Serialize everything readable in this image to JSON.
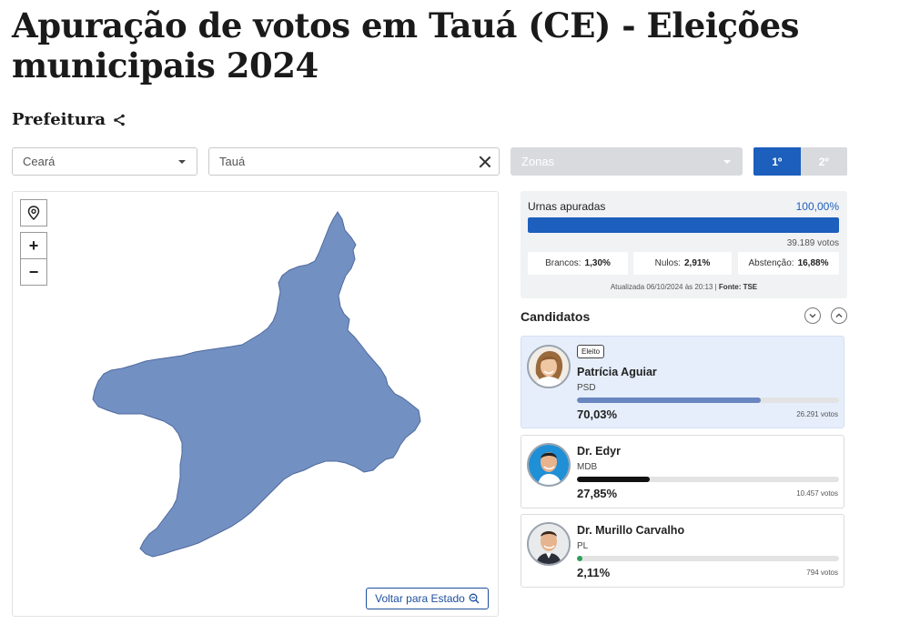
{
  "header": {
    "title": "Apuração de votos em Tauá (CE) - Eleições municipais 2024",
    "section": "Prefeitura"
  },
  "filters": {
    "state": "Ceará",
    "city": "Tauá",
    "zones_placeholder": "Zonas",
    "round_first": "1º",
    "round_second": "2º",
    "active_round": "1º"
  },
  "map": {
    "zoom_in_label": "+",
    "zoom_out_label": "−",
    "back_button_label": "Voltar para Estado",
    "fill_color": "#7390c2"
  },
  "summary": {
    "urnas_label": "Urnas apuradas",
    "urnas_value": "100,00%",
    "urnas_progress": 1.0,
    "total_votes": "39.189 votos",
    "brancos_label": "Brancos:",
    "brancos_value": "1,30%",
    "nulos_label": "Nulos:",
    "nulos_value": "2,91%",
    "abstencao_label": "Abstenção:",
    "abstencao_value": "16,88%",
    "updated_text": "Atualizada 06/10/2024 às 20:13 |",
    "source_text": "Fonte: TSE"
  },
  "candidates": {
    "title": "Candidatos",
    "list": [
      {
        "badge": "Eleito",
        "name": "Patrícia Aguiar",
        "party": "PSD",
        "pct": "70,03%",
        "votes": "26.291 votos",
        "fraction": 0.7003,
        "bar_color": "#6a86c0"
      },
      {
        "name": "Dr. Edyr",
        "party": "MDB",
        "pct": "27,85%",
        "votes": "10.457 votos",
        "fraction": 0.2785,
        "bar_color": "#111111"
      },
      {
        "name": "Dr. Murillo Carvalho",
        "party": "PL",
        "pct": "2,11%",
        "votes": "794 votos",
        "fraction": 0.0211,
        "bar_color": "#2e9d5a"
      }
    ]
  },
  "colors": {
    "accent": "#1c5fbd",
    "panel_bg": "#f1f2f4",
    "winner_bg": "#e6eefb"
  }
}
